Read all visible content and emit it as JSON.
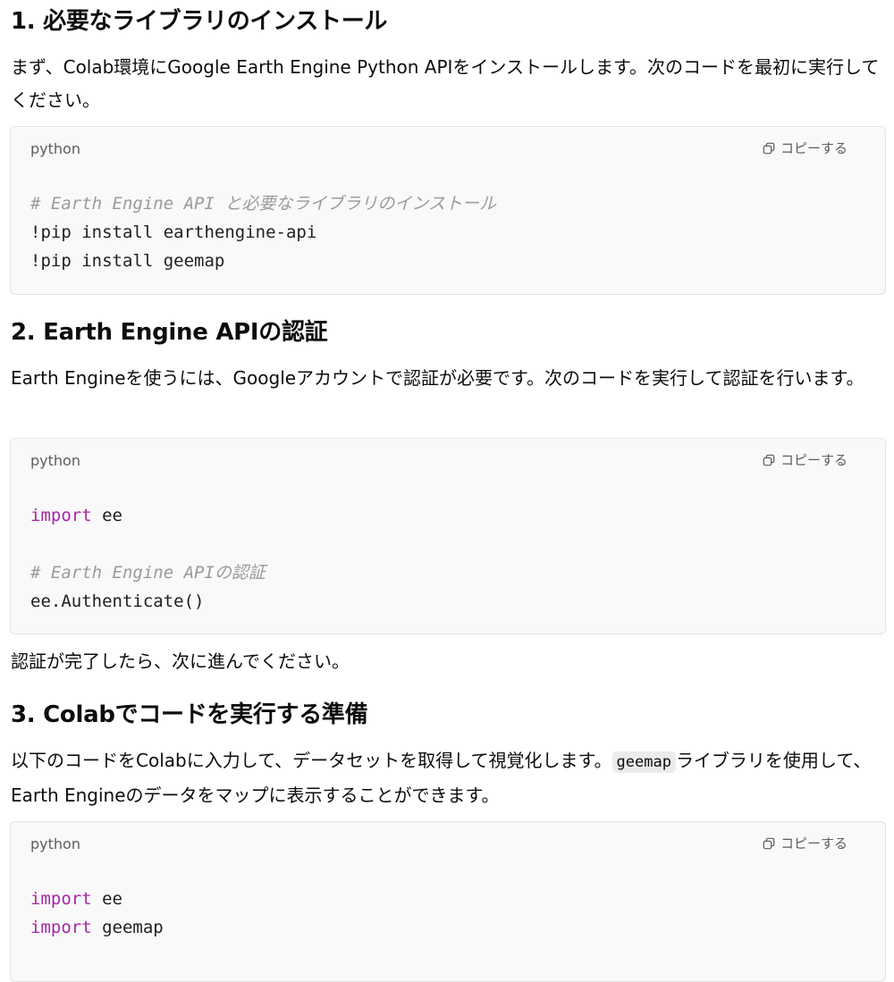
{
  "sections": [
    {
      "heading": "1. 必要なライブラリのインストール",
      "intro": "まず、Colab環境にGoogle Earth Engine Python APIをインストールします。次のコードを最初に実行してください。",
      "code": {
        "language": "python",
        "copy_label": "コピーする",
        "lines": [
          {
            "comment": "# Earth Engine API と必要なライブラリのインストール"
          },
          {
            "text": "!pip install earthengine-api"
          },
          {
            "text": "!pip install geemap"
          }
        ]
      }
    },
    {
      "heading": "2. Earth Engine APIの認証",
      "intro": "Earth Engineを使うには、Googleアカウントで認証が必要です。次のコードを実行して認証を行います。",
      "code": {
        "language": "python",
        "copy_label": "コピーする",
        "lines": [
          {
            "keyword": "import",
            "text": " ee"
          },
          {},
          {
            "comment": "# Earth Engine APIの認証"
          },
          {
            "text": "ee.Authenticate()"
          }
        ]
      },
      "after": "認証が完了したら、次に進んでください。"
    },
    {
      "heading": "3. Colabでコードを実行する準備",
      "intro_before": "以下のコードをColabに入力して、データセットを取得して視覚化します。",
      "intro_code": "geemap",
      "intro_after": "ライブラリを使用して、Earth Engineのデータをマップに表示することができます。",
      "code": {
        "language": "python",
        "copy_label": "コピーする",
        "lines": [
          {
            "keyword": "import",
            "text": " ee"
          },
          {
            "keyword": "import",
            "text": " geemap"
          }
        ]
      }
    }
  ],
  "icons": {
    "copy": "copy-icon"
  },
  "colors": {
    "keyword": "#a626a4",
    "comment": "#9a9a9a",
    "code_background": "#f9f9f9"
  }
}
